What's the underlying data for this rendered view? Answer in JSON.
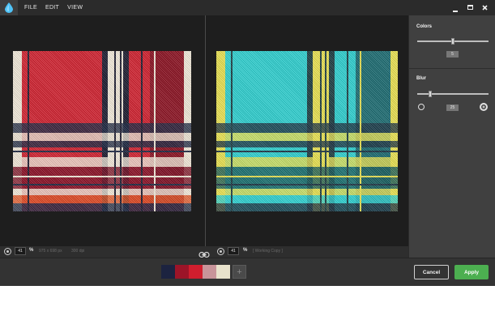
{
  "menu": {
    "items": [
      "FILE",
      "EDIT",
      "VIEW"
    ]
  },
  "window_controls": {
    "minimize": "–",
    "maximize": "◻",
    "close": "✕"
  },
  "sidebar": {
    "colors": {
      "title": "Colors",
      "value": "5",
      "slider_level": 0.5
    },
    "blur": {
      "title": "Blur",
      "value": "25",
      "slider_level": 0.18
    }
  },
  "left_panel": {
    "zoom_value": "41",
    "zoom_unit": "%",
    "dimensions": "975 x 698 px",
    "dpi": "300 dpi",
    "plaid": {
      "base": "#e8dfd0",
      "bands": [
        {
          "axis": "v",
          "from": 0,
          "to": 0.05,
          "color": "#f0e8d8"
        },
        {
          "axis": "v",
          "from": 0.05,
          "to": 0.5,
          "color": "#d0202e"
        },
        {
          "axis": "v",
          "from": 0.5,
          "to": 0.53,
          "color": "#1a1a2e"
        },
        {
          "axis": "v",
          "from": 0.53,
          "to": 0.62,
          "color": "#f0e8d8"
        },
        {
          "axis": "v",
          "from": 0.62,
          "to": 0.65,
          "color": "#1a1a2e"
        },
        {
          "axis": "v",
          "from": 0.65,
          "to": 0.77,
          "color": "#d0202e"
        },
        {
          "axis": "v",
          "from": 0.77,
          "to": 0.96,
          "color": "#8a1020"
        },
        {
          "axis": "v",
          "from": 0.96,
          "to": 1,
          "color": "#f0e8d8"
        },
        {
          "axis": "h",
          "from": 0.45,
          "to": 0.51,
          "color": "#1a2540"
        },
        {
          "axis": "h",
          "from": 0.51,
          "to": 0.56,
          "color": "#e8dfd0"
        },
        {
          "axis": "h",
          "from": 0.56,
          "to": 0.6,
          "color": "#1a2540"
        },
        {
          "axis": "h",
          "from": 0.66,
          "to": 0.72,
          "color": "#f0e8d8"
        },
        {
          "axis": "h",
          "from": 0.72,
          "to": 0.86,
          "color": "#7a0c22"
        },
        {
          "axis": "h",
          "from": 0.86,
          "to": 0.9,
          "color": "#f0e8d8"
        },
        {
          "axis": "h",
          "from": 0.9,
          "to": 0.95,
          "color": "#e05020"
        },
        {
          "axis": "h",
          "from": 0.95,
          "to": 1,
          "color": "#1a2540"
        }
      ],
      "lines": [
        {
          "axis": "v",
          "at": 0.08,
          "color": "#1a1a2e"
        },
        {
          "axis": "v",
          "at": 0.57,
          "color": "#1a1a2e"
        },
        {
          "axis": "v",
          "at": 0.6,
          "color": "#1a1a2e"
        },
        {
          "axis": "v",
          "at": 0.72,
          "color": "#1a1a2e"
        },
        {
          "axis": "v",
          "at": 0.79,
          "color": "#f0e8d8"
        },
        {
          "axis": "h",
          "at": 0.62,
          "color": "#1a2540"
        },
        {
          "axis": "h",
          "at": 0.78,
          "color": "#f0e8d8"
        },
        {
          "axis": "h",
          "at": 0.83,
          "color": "#1a2540"
        }
      ]
    }
  },
  "right_panel": {
    "zoom_value": "41",
    "zoom_unit": "%",
    "label": "[ Working Copy ]",
    "plaid": {
      "base": "#e8e050",
      "bands": [
        {
          "axis": "v",
          "from": 0,
          "to": 0.05,
          "color": "#e8e050"
        },
        {
          "axis": "v",
          "from": 0.05,
          "to": 0.5,
          "color": "#2dcfcf"
        },
        {
          "axis": "v",
          "from": 0.5,
          "to": 0.53,
          "color": "#1a3a40"
        },
        {
          "axis": "v",
          "from": 0.53,
          "to": 0.62,
          "color": "#e8e050"
        },
        {
          "axis": "v",
          "from": 0.62,
          "to": 0.65,
          "color": "#1a3a40"
        },
        {
          "axis": "v",
          "from": 0.65,
          "to": 0.77,
          "color": "#2dcfcf"
        },
        {
          "axis": "v",
          "from": 0.77,
          "to": 0.96,
          "color": "#1a6a70"
        },
        {
          "axis": "v",
          "from": 0.96,
          "to": 1,
          "color": "#e8e050"
        },
        {
          "axis": "h",
          "from": 0.45,
          "to": 0.51,
          "color": "#1a3040"
        },
        {
          "axis": "h",
          "from": 0.51,
          "to": 0.56,
          "color": "#e8e050"
        },
        {
          "axis": "h",
          "from": 0.56,
          "to": 0.6,
          "color": "#1a3040"
        },
        {
          "axis": "h",
          "from": 0.66,
          "to": 0.72,
          "color": "#e8e050"
        },
        {
          "axis": "h",
          "from": 0.72,
          "to": 0.86,
          "color": "#165a5a"
        },
        {
          "axis": "h",
          "from": 0.86,
          "to": 0.9,
          "color": "#e8e050"
        },
        {
          "axis": "h",
          "from": 0.9,
          "to": 0.95,
          "color": "#2dcfcf"
        },
        {
          "axis": "h",
          "from": 0.95,
          "to": 1,
          "color": "#1a3040"
        }
      ],
      "lines": [
        {
          "axis": "v",
          "at": 0.08,
          "color": "#1a3a40"
        },
        {
          "axis": "v",
          "at": 0.57,
          "color": "#1a3a40"
        },
        {
          "axis": "v",
          "at": 0.6,
          "color": "#1a3a40"
        },
        {
          "axis": "v",
          "at": 0.72,
          "color": "#1a3a40"
        },
        {
          "axis": "v",
          "at": 0.79,
          "color": "#e8e050"
        },
        {
          "axis": "h",
          "at": 0.62,
          "color": "#1a3040"
        },
        {
          "axis": "h",
          "at": 0.78,
          "color": "#e8e050"
        },
        {
          "axis": "h",
          "at": 0.83,
          "color": "#1a3040"
        }
      ]
    }
  },
  "palette": {
    "swatches": [
      "#1c2340",
      "#9c1428",
      "#d11e2e",
      "#c8949a",
      "#e8e2cc"
    ],
    "add_label": "+"
  },
  "buttons": {
    "cancel": "Cancel",
    "apply": "Apply"
  },
  "colors": {
    "accent": "#4caf50",
    "logo": "#4fc3f7"
  }
}
